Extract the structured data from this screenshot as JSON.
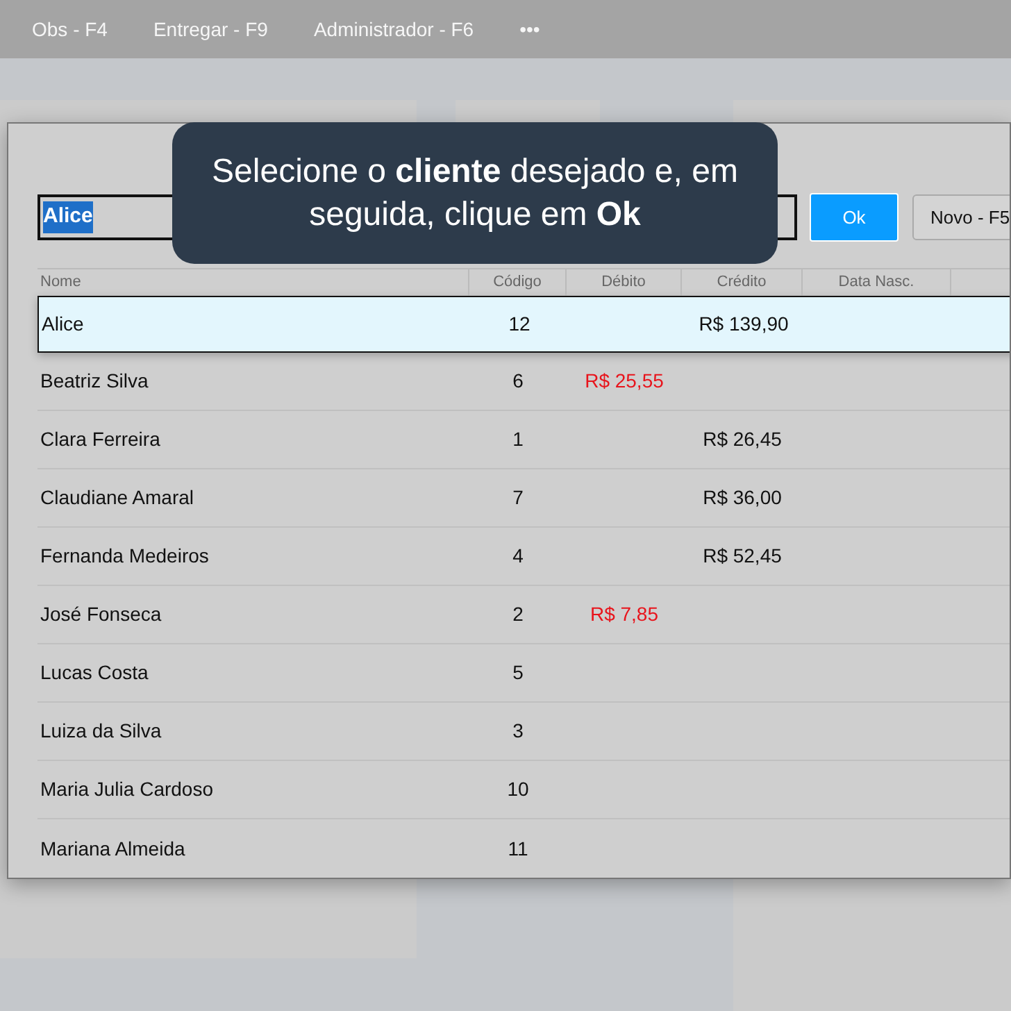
{
  "menu": [
    "Obs - F4",
    "Entregar - F9",
    "Administrador - F6",
    "•••"
  ],
  "search": {
    "value": "Alice"
  },
  "buttons": [
    {
      "label": "Ok",
      "kind": "primary"
    },
    {
      "label": "Novo - F5",
      "kind": "secondary"
    }
  ],
  "tooltip": {
    "text": "Selecione o **cliente** desejado e, em seguida, clique em **Ok**"
  },
  "table": {
    "columns": [
      "Nome",
      "Código",
      "Débito",
      "Crédito",
      "Data Nasc."
    ],
    "rows": [
      {
        "name": "Alice",
        "code": "12",
        "credit": "R$ 139,90",
        "selected": true
      },
      {
        "name": "Beatriz Silva",
        "code": "6",
        "debit": "R$ 25,55",
        "selected": false
      },
      {
        "name": "Clara Ferreira",
        "code": "1",
        "credit": "R$ 26,45",
        "selected": false
      },
      {
        "name": "Claudiane Amaral",
        "code": "7",
        "credit": "R$ 36,00",
        "selected": false
      },
      {
        "name": "Fernanda Medeiros",
        "code": "4",
        "credit": "R$ 52,45",
        "selected": false
      },
      {
        "name": "José Fonseca",
        "code": "2",
        "debit": "R$ 7,85",
        "selected": false
      },
      {
        "name": "Lucas Costa",
        "code": "5",
        "selected": false
      },
      {
        "name": "Luiza da Silva",
        "code": "3",
        "selected": false
      },
      {
        "name": "Maria Julia Cardoso",
        "code": "10",
        "selected": false
      },
      {
        "name": "Mariana Almeida",
        "code": "11",
        "selected": false
      }
    ]
  }
}
